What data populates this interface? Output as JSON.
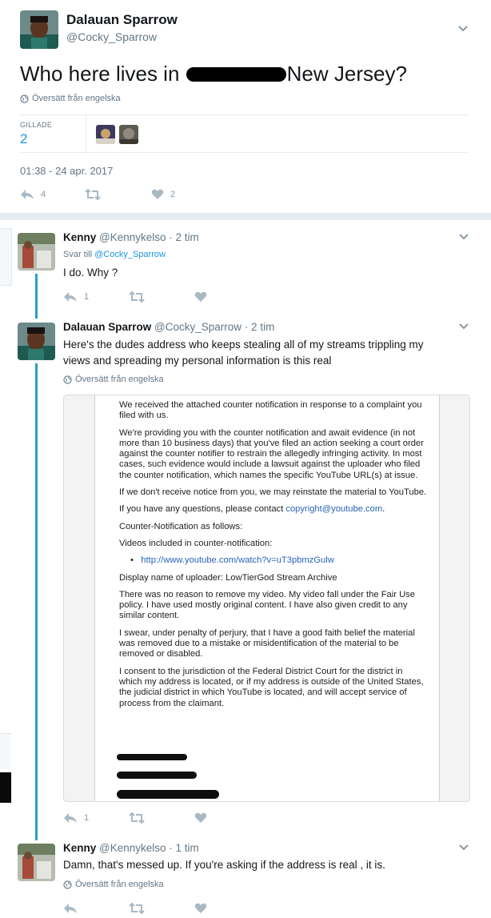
{
  "main_tweet": {
    "author_name": "Dalauan Sparrow",
    "author_handle": "@Cocky_Sparrow",
    "text_before": "Who here lives in",
    "text_after": "New Jersey?",
    "translate_label": "Översätt från engelska",
    "likes_label": "GILLADE",
    "likes_count": "2",
    "timestamp": "01:38 - 24 apr. 2017",
    "reply_count": "4",
    "like_count": "2"
  },
  "replies": [
    {
      "author_name": "Kenny",
      "author_handle": "@Kennykelso",
      "time": "· 2 tim",
      "reply_to_prefix": "Svar till",
      "reply_to_handle": "@Cocky_Sparrow",
      "text": "I do. Why ?",
      "reply_count": "1"
    },
    {
      "author_name": "Dalauan Sparrow",
      "author_handle": "@Cocky_Sparrow",
      "time": "· 2 tim",
      "text_line1": "Here's the dudes address who keeps stealing all of my streams trippling my",
      "text_line2": "views and spreading my personal information is this real",
      "translate_label": "Översätt från engelska",
      "reply_count": "1"
    },
    {
      "author_name": "Kenny",
      "author_handle": "@Kennykelso",
      "time": "· 1 tim",
      "text": "Damn, that's messed up. If you're asking if the address is real , it is.",
      "translate_label": "Översätt från engelska"
    }
  ],
  "attached_document": {
    "p1": "We received the attached counter notification in response to a complaint you filed with us.",
    "p2": "We're providing you with the counter notification and await evidence (in not more than 10 business days) that you've filed an action seeking a court order against the counter notifier to restrain the allegedly infringing activity. In most cases, such evidence would include a lawsuit against the uploader who filed the counter notification, which names the specific YouTube URL(s) at issue.",
    "p3": "If we don't receive notice from you, we may reinstate the material to YouTube.",
    "p4_prefix": "If you have any questions, please contact ",
    "p4_link": "copyright@youtube.com",
    "p4_suffix": ".",
    "p5": "Counter-Notification as follows:",
    "p6": "Videos included in counter-notification:",
    "video_url": "http://www.youtube.com/watch?v=uT3pbmzGulw",
    "p7": "Display name of uploader: LowTierGod Stream Archive",
    "p8": "There was no reason to remove my video. My video fall under the Fair Use policy. I have used mostly original content. I have also given credit to any similar content.",
    "p9": "I swear, under penalty of perjury, that I have a good faith belief the material was removed due to a mistake or misidentification of the material to be removed or disabled.",
    "p10": "I consent to the jurisdiction of the Federal District Court for the district in which my address is located, or if my address is outside of the United States, the judicial district in which YouTube is located, and will accept service of process from the claimant."
  },
  "icons": {
    "translate": "globe-icon",
    "reply": "reply-arrow-icon",
    "retweet": "retweet-icon",
    "like": "heart-icon",
    "more": "chevron-down-icon"
  },
  "colors": {
    "link": "#1b95e0",
    "muted": "#657786",
    "icon": "#aab8c2",
    "thread_line": "#2aa0c8"
  }
}
